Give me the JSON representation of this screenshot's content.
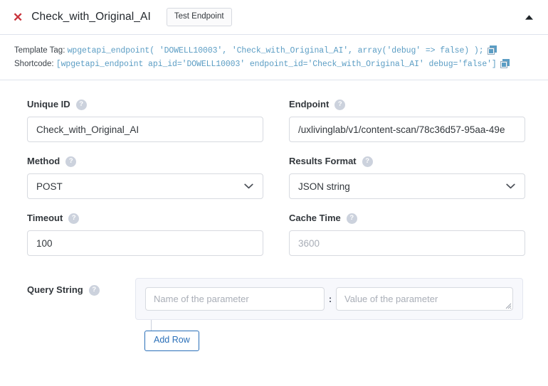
{
  "header": {
    "close_icon": "close-x-icon",
    "title": "Check_with_Original_AI",
    "test_button_label": "Test Endpoint",
    "collapse_icon": "chevron-up-icon",
    "accent_red": "#c9343c"
  },
  "code_block": {
    "template_tag": {
      "label": "Template Tag:",
      "code": "wpgetapi_endpoint( 'DOWELL10003', 'Check_with_Original_AI', array('debug' => false) );",
      "copy_icon": "copy-icon"
    },
    "shortcode": {
      "label": "Shortcode:",
      "code": "[wpgetapi_endpoint api_id='DOWELL10003' endpoint_id='Check_with_Original_AI' debug='false']",
      "copy_icon": "copy-icon"
    },
    "code_color": "#5b9dc4"
  },
  "fields": {
    "unique_id": {
      "label": "Unique ID",
      "help_icon": "help-question-icon",
      "help_glyph": "?",
      "value": "Check_with_Original_AI",
      "placeholder": ""
    },
    "endpoint": {
      "label": "Endpoint",
      "help_icon": "help-question-icon",
      "help_glyph": "?",
      "value": "/uxlivinglab/v1/content-scan/78c36d57-95aa-49e",
      "placeholder": ""
    },
    "method": {
      "label": "Method",
      "help_icon": "help-question-icon",
      "help_glyph": "?",
      "value": "POST",
      "chevron_icon": "chevron-down-icon"
    },
    "results_format": {
      "label": "Results Format",
      "help_icon": "help-question-icon",
      "help_glyph": "?",
      "value": "JSON string",
      "chevron_icon": "chevron-down-icon"
    },
    "timeout": {
      "label": "Timeout",
      "help_icon": "help-question-icon",
      "help_glyph": "?",
      "value": "100",
      "placeholder": ""
    },
    "cache_time": {
      "label": "Cache Time",
      "help_icon": "help-question-icon",
      "help_glyph": "?",
      "value": "",
      "placeholder": "3600"
    }
  },
  "query_string": {
    "label": "Query String",
    "help_icon": "help-question-icon",
    "help_glyph": "?",
    "rows": [
      {
        "name_placeholder": "Name of the parameter",
        "name_value": "",
        "separator": ":",
        "value_placeholder": "Value of the parameter",
        "value_value": ""
      }
    ],
    "add_row_label": "Add Row",
    "add_row_color": "#2a6fb8"
  }
}
